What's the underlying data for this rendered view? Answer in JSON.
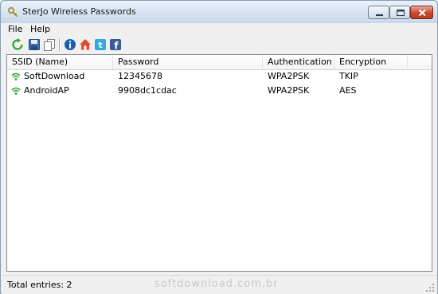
{
  "window": {
    "title": "SterJo Wireless Passwords"
  },
  "menu": {
    "items": [
      "File",
      "Help"
    ]
  },
  "toolbar": {
    "buttons": [
      "refresh-icon",
      "save-icon",
      "copy-icon",
      "info-icon",
      "home-icon",
      "twitter-icon",
      "facebook-icon"
    ]
  },
  "table": {
    "columns": [
      "SSID (Name)",
      "Password",
      "Authentication",
      "Encryption"
    ],
    "rows": [
      {
        "ssid": "SoftDownload",
        "password": "12345678",
        "auth": "WPA2PSK",
        "enc": "TKIP"
      },
      {
        "ssid": "AndroidAP",
        "password": "9908dc1cdac",
        "auth": "WPA2PSK",
        "enc": "AES"
      }
    ]
  },
  "status": {
    "text": "Total entries: 2",
    "watermark": "softdownload.com.br"
  },
  "colors": {
    "wifi": "#2aa52a",
    "close": "#c9482f",
    "info": "#1a5fb4",
    "facebook": "#3b5998",
    "twitter": "#33aadd"
  }
}
